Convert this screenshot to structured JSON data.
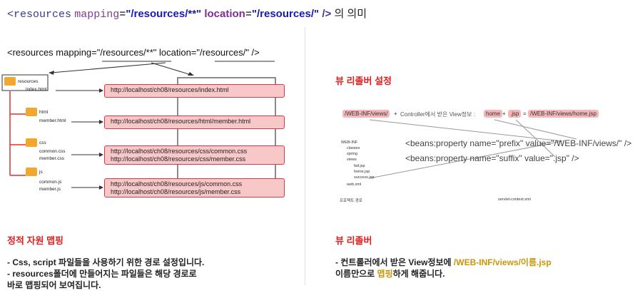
{
  "title": {
    "tag_open": "<resources",
    "mapping_attr": "mapping",
    "eq": "=",
    "mapping_val": "\"/resources/**\"",
    "location_attr": "location",
    "location_val": "\"/resources/\"",
    "close": "/>",
    "korean": "의 의미"
  },
  "left_diagram": {
    "code_line": "<resources mapping=\"/resources/**\" location=\"/resources/\" />",
    "tree": {
      "root": "resources",
      "root_file": "index.html",
      "folders": [
        {
          "name": "html",
          "files": [
            "member.html"
          ]
        },
        {
          "name": "css",
          "files": [
            "common.css",
            "member.css"
          ]
        },
        {
          "name": "js",
          "files": [
            "common.js",
            "member.js"
          ]
        }
      ]
    },
    "urls": [
      [
        "http://localhost/ch08/resources/index.html"
      ],
      [
        "http://localhost/ch08/resources/html/member.html"
      ],
      [
        "http://localhost/ch08/resources/css/common.css",
        "http://localhost/ch08/resources/css/member.css"
      ],
      [
        "http://localhost/ch08/resources/js/common.css",
        "http://localhost/ch08/resources/js/member.css"
      ]
    ]
  },
  "left_section": {
    "heading": "정적 자원 맵핑",
    "line1": "- Css, script 파일들을 사용하기 위한 경로 설정입니다.",
    "line2": "- resources폴더에 만들어지는 파일들은 해당 경로로",
    "line3": "바로 맵핑되어 보여집니다."
  },
  "right_top": {
    "heading": "뷰 리졸버 설정"
  },
  "right_diagram": {
    "pill_prefix": "/WEB-INF/views/",
    "plus1": "+",
    "mid_text": "Controller에서 받은 View정보 :",
    "pill_home": "home",
    "plus2": "+",
    "pill_jsp": ".jsp",
    "eq": "=",
    "pill_result": "/WEB-INF/views/home.jsp",
    "bean1": "<beans:property name=\"prefix\" value=\"/WEB-INF/views/\" />",
    "bean2": "<beans:property name=\"suffix\" value=\".jsp\" />",
    "tree": [
      "WEB-INF",
      "classes",
      "spring",
      "views",
      "fail.jsp",
      "home.jsp",
      "success.jsp",
      "web.xml"
    ],
    "caption_left": "프로젝트 경로",
    "caption_right": "servlet-context.xml"
  },
  "right_section": {
    "heading": "뷰 리졸버",
    "line1_a": "- 컨트롤러에서 받은 View정보에 ",
    "line1_hl": "/WEB-INF/views/이름.jsp",
    "line2_a": "이름만으로 ",
    "line2_hl": "맵핑",
    "line2_b": "하게 해줍니다."
  },
  "colors": {
    "heading_red": "#e02020",
    "highlight": "#c8960a",
    "url_box_fill": "#f8c8c8",
    "url_box_border": "#d43a4a"
  }
}
